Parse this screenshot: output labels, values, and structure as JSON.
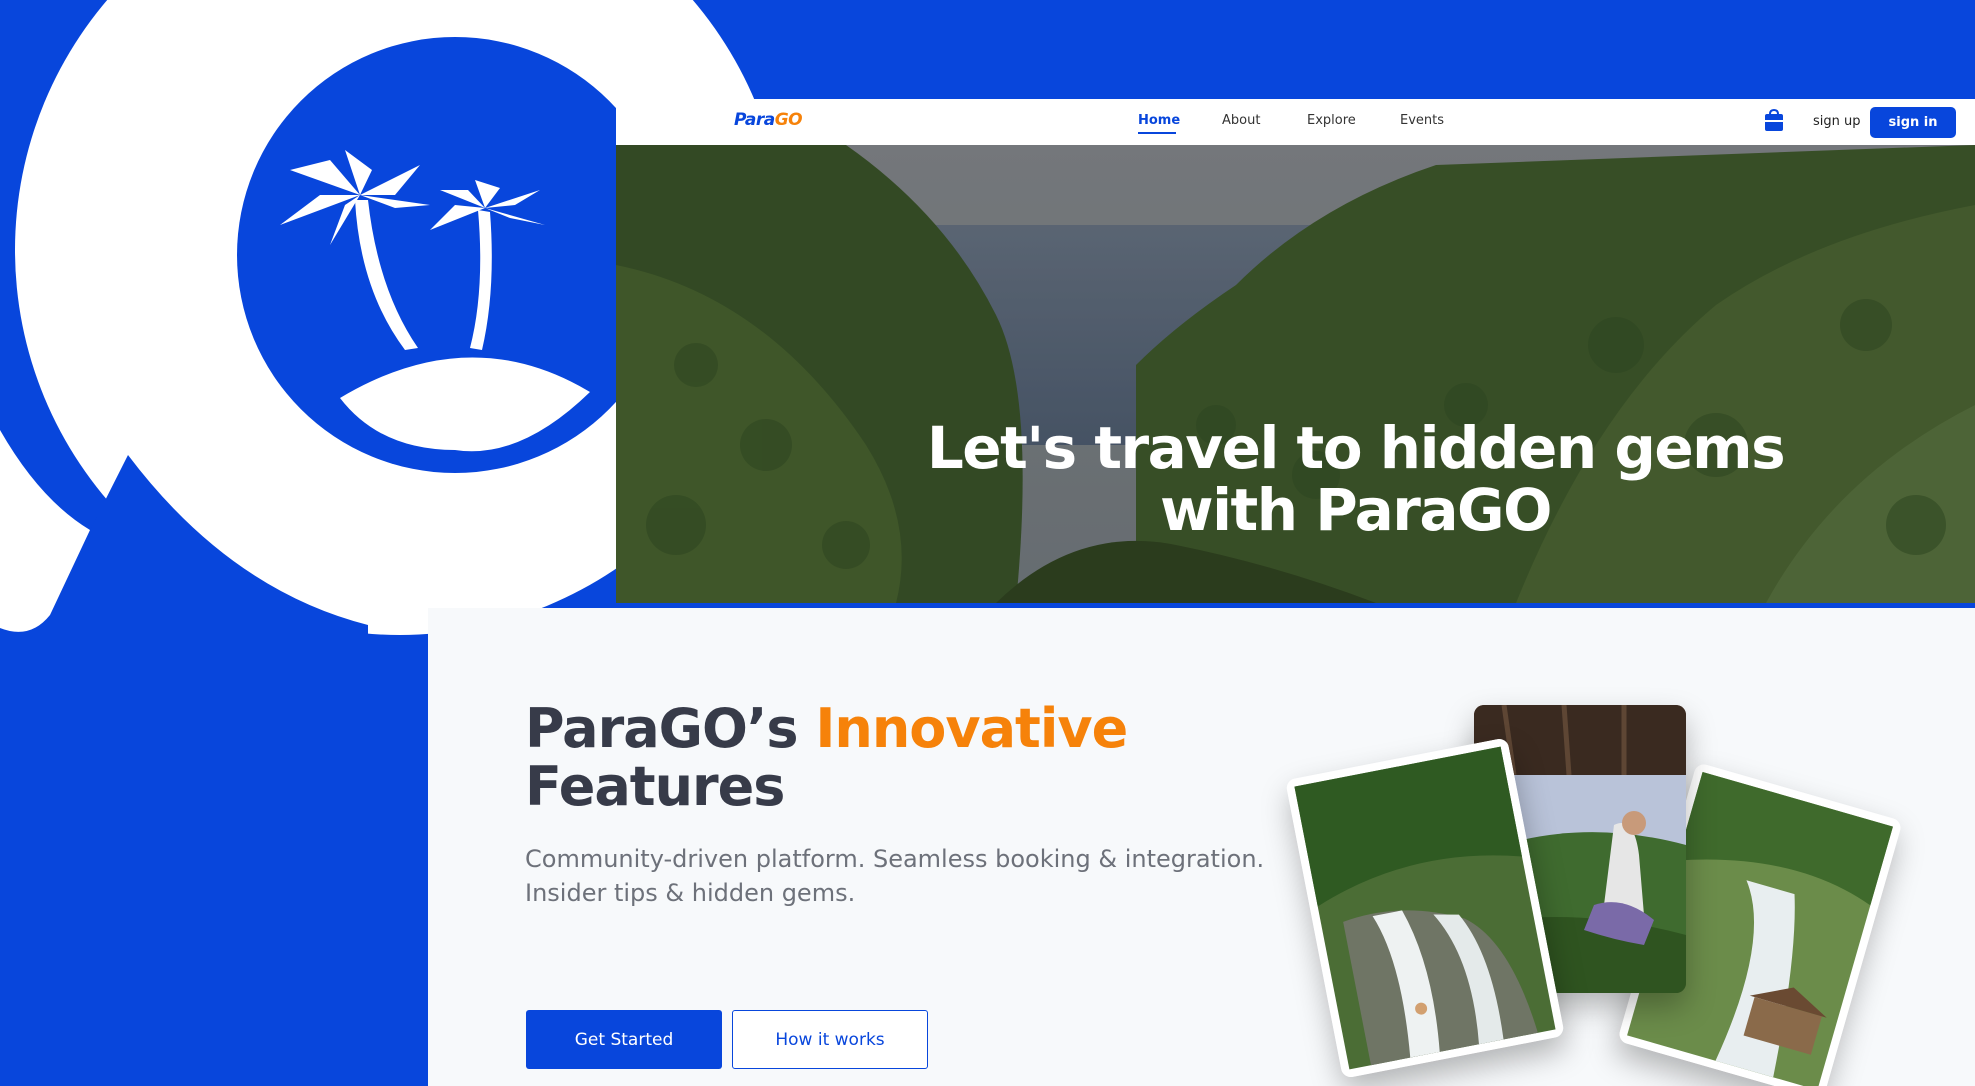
{
  "nav": {
    "logo_part1": "Para",
    "logo_part2": "GO",
    "links": [
      {
        "label": "Home",
        "active": true
      },
      {
        "label": "About",
        "active": false
      },
      {
        "label": "Explore",
        "active": false
      },
      {
        "label": "Events",
        "active": false
      }
    ],
    "cart_icon": "shopping-bag-icon",
    "signup_label": "sign up",
    "signin_label": "sign in"
  },
  "hero": {
    "title_line1": "Let's travel to hidden gems",
    "title_line2": "with ParaGO"
  },
  "features": {
    "title_part1": "ParaGO’s ",
    "title_highlight": "Innovative",
    "title_part2": "Features",
    "description_line1": "Community-driven platform. Seamless booking & integration.",
    "description_line2": "Insider tips & hidden gems.",
    "primary_button": "Get Started",
    "secondary_button": "How it works"
  },
  "brand_icon": "palm-island-search-icon",
  "colors": {
    "brand_blue": "#0846dc",
    "accent_orange": "#f6820a",
    "heading_dark": "#373b49",
    "muted_text": "#6d717a"
  }
}
